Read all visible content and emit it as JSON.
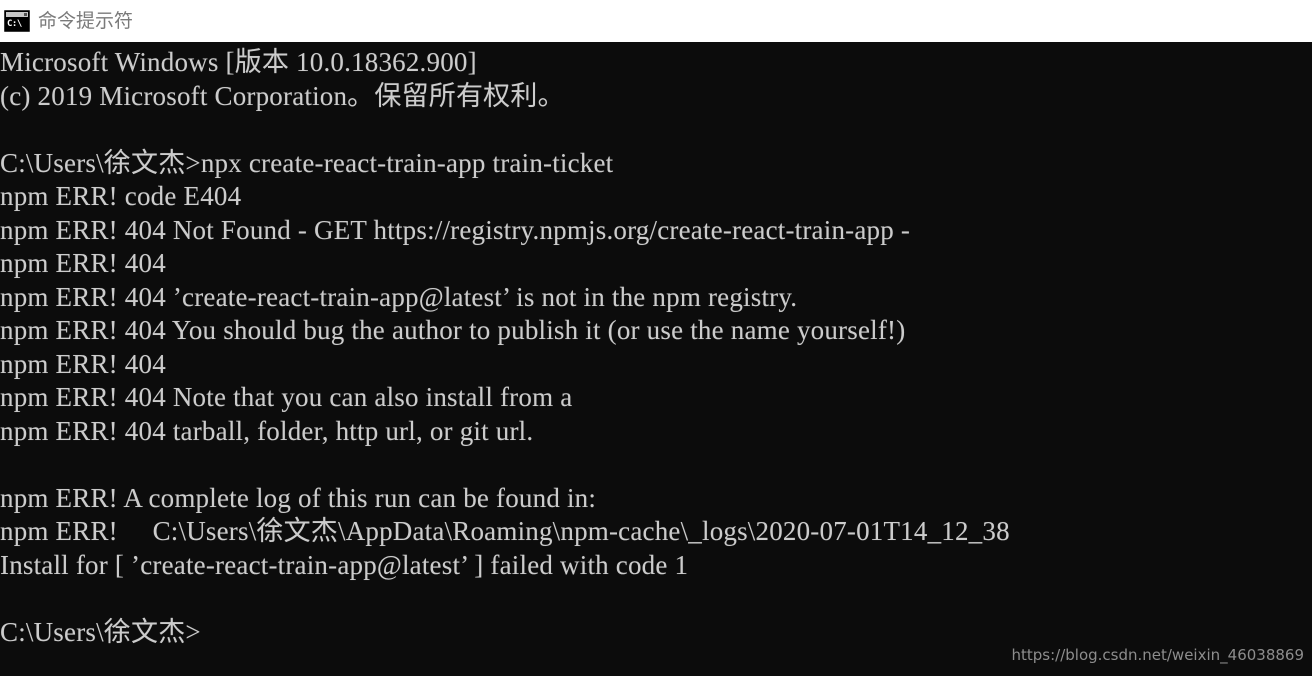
{
  "titlebar": {
    "title": "命令提示符",
    "icon": "cmd-prompt-icon",
    "icon_text": "C:\\",
    "background_color": "#ffffff",
    "text_color": "#7a7a7a"
  },
  "console": {
    "background_color": "#0c0c0c",
    "text_color": "#cccccc",
    "lines": [
      "Microsoft Windows [版本 10.0.18362.900]",
      "(c) 2019 Microsoft Corporation。保留所有权利。",
      "",
      "C:\\Users\\徐文杰>npx create-react-train-app train-ticket",
      "npm ERR! code E404",
      "npm ERR! 404 Not Found - GET https://registry.npmjs.org/create-react-train-app -",
      "npm ERR! 404",
      "npm ERR! 404 ’create-react-train-app@latest’ is not in the npm registry.",
      "npm ERR! 404 You should bug the author to publish it (or use the name yourself!)",
      "npm ERR! 404",
      "npm ERR! 404 Note that you can also install from a",
      "npm ERR! 404 tarball, folder, http url, or git url.",
      "",
      "npm ERR! A complete log of this run can be found in:",
      "npm ERR!     C:\\Users\\徐文杰\\AppData\\Roaming\\npm-cache\\_logs\\2020-07-01T14_12_38",
      "Install for [ ’create-react-train-app@latest’ ] failed with code 1",
      "",
      "C:\\Users\\徐文杰>"
    ]
  },
  "watermark": {
    "text": "https://blog.csdn.net/weixin_46038869"
  }
}
